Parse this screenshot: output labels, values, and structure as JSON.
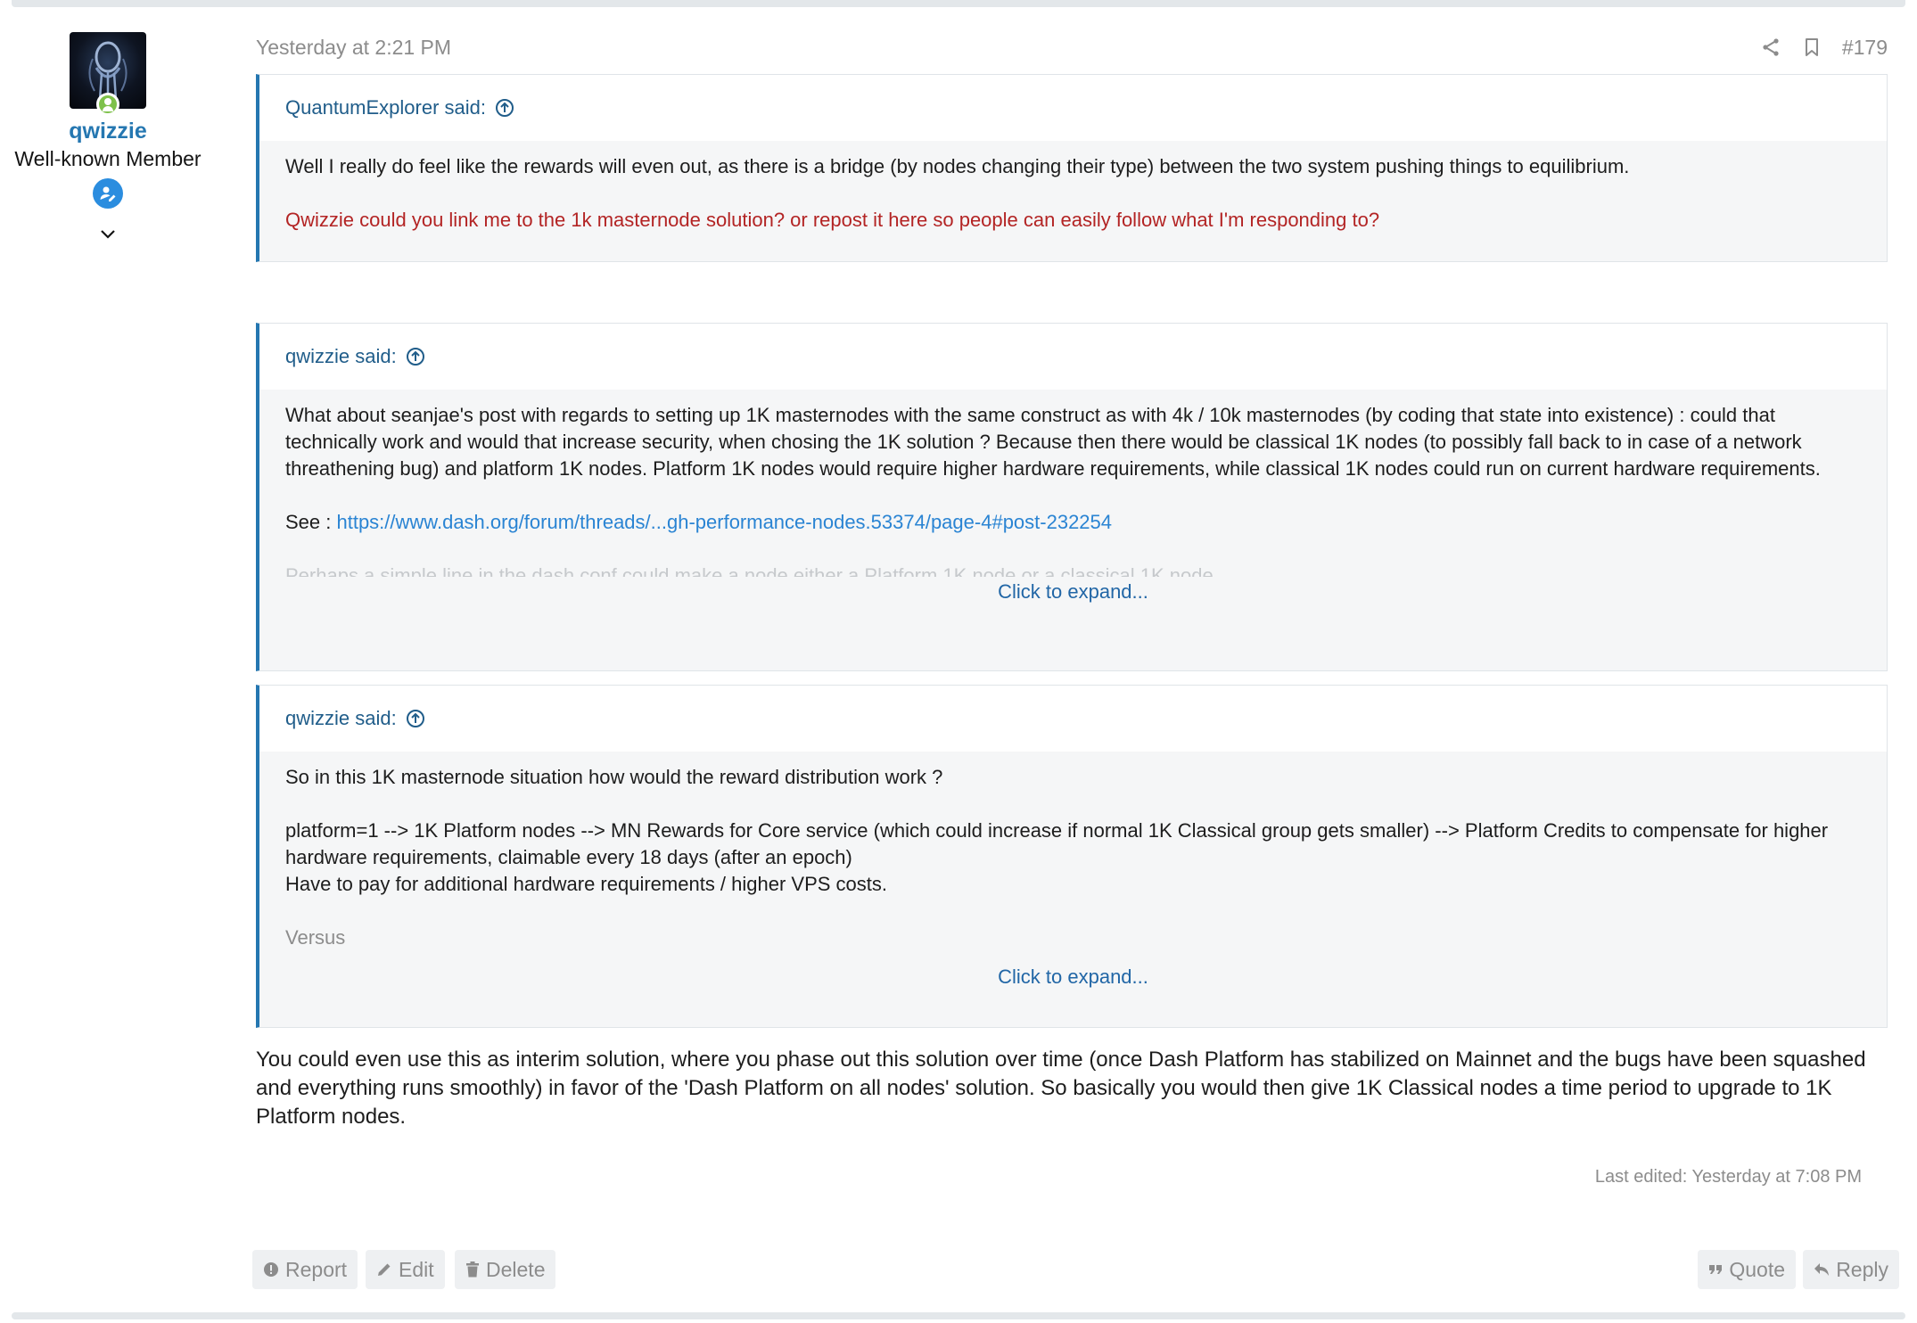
{
  "user": {
    "username": "qwizzie",
    "title": "Well-known Member"
  },
  "post": {
    "timestamp": "Yesterday at 2:21 PM",
    "number": "#179",
    "quotes": [
      {
        "author": "QuantumExplorer said:",
        "paragraphs": [
          "Well I really do feel like the rewards will even out, as there is a bridge (by nodes changing their type) between the two system pushing things to equilibrium.",
          "Qwizzie could you link me to the 1k masternode solution? or repost it here so people can easily follow what I'm responding to?"
        ]
      },
      {
        "author": "qwizzie said:",
        "paragraph1": "What about seanjae's post with regards to setting up 1K masternodes with the same construct as with 4k / 10k masternodes (by coding that state into existence) : could that technically work and would that increase security, when chosing the 1K solution ? Because then there would be classical 1K nodes (to possibly fall back to in case of a network threathening bug) and platform 1K nodes. Platform 1K nodes would require higher hardware requirements, while classical 1K nodes could run on current hardware requirements.",
        "see_label": "See : ",
        "link_text": "https://www.dash.org/forum/threads/...gh-performance-nodes.53374/page-4#post-232254",
        "faded_line": "Perhaps a simple line in the dash.conf could make a node either a Platform 1K node or a classical 1K node",
        "expand_label": "Click to expand..."
      },
      {
        "author": "qwizzie said:",
        "paragraph1": "So in this 1K masternode situation how would the reward distribution work ?",
        "paragraph2_line1": "platform=1 --> 1K Platform nodes --> MN Rewards for Core service (which could increase if normal 1K Classical group gets smaller) --> Platform Credits to compensate for higher hardware requirements, claimable every 18 days (after an epoch)",
        "paragraph2_line2": "Have to pay for additional hardware requirements / higher VPS costs.",
        "faded_line": "Versus",
        "expand_label": "Click to expand..."
      }
    ],
    "message": "You could even use this as interim solution, where you phase out this solution over time (once Dash Platform has stabilized on Mainnet and the bugs have been squashed and everything runs smoothly) in favor of the 'Dash Platform on all nodes' solution. So basically you would then give 1K Classical nodes a time period to upgrade to 1K Platform nodes.",
    "last_edited": "Last edited: Yesterday at 7:08 PM"
  },
  "actions": {
    "report": "Report",
    "edit": "Edit",
    "delete": "Delete",
    "quote": "Quote",
    "reply": "Reply"
  },
  "icons": [
    "share-icon",
    "bookmark-icon",
    "arrow-up-circle-icon",
    "user-online-icon",
    "member-badge-icon",
    "chevron-down-icon",
    "report-icon",
    "edit-icon",
    "delete-icon",
    "quote-icon",
    "reply-icon"
  ]
}
